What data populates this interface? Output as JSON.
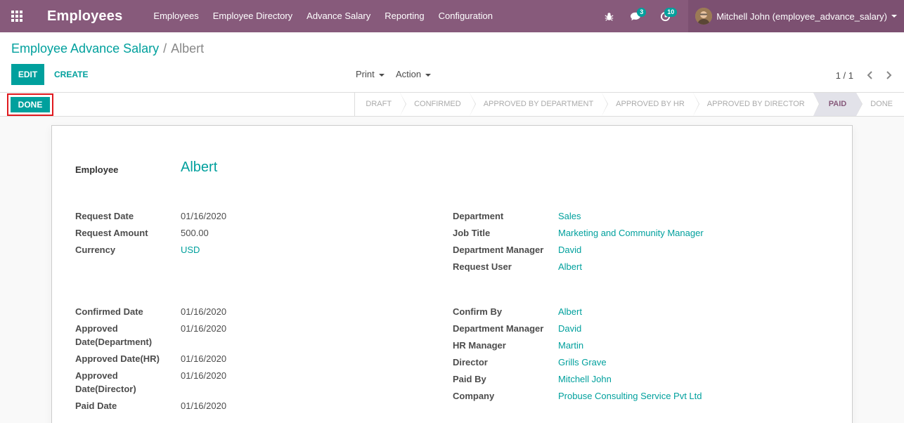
{
  "navbar": {
    "app_title": "Employees",
    "menu": [
      "Employees",
      "Employee Directory",
      "Advance Salary",
      "Reporting",
      "Configuration"
    ],
    "messages_count": "3",
    "activities_count": "10",
    "user": "Mitchell John (employee_advance_salary)"
  },
  "breadcrumb": {
    "parent": "Employee Advance Salary",
    "separator": "/",
    "current": "Albert"
  },
  "buttons": {
    "edit": "EDIT",
    "create": "CREATE",
    "print": "Print",
    "action": "Action",
    "done": "DONE"
  },
  "pager": {
    "value": "1 / 1"
  },
  "stages": [
    "DRAFT",
    "CONFIRMED",
    "APPROVED BY DEPARTMENT",
    "APPROVED BY HR",
    "APPROVED BY DIRECTOR",
    "PAID",
    "DONE"
  ],
  "active_stage": "PAID",
  "form": {
    "employee_label": "Employee",
    "employee": "Albert",
    "left1": [
      {
        "label": "Request Date",
        "value": "01/16/2020"
      },
      {
        "label": "Request Amount",
        "value": "500.00"
      },
      {
        "label": "Currency",
        "value": "USD"
      }
    ],
    "right1": [
      {
        "label": "Department",
        "value": "Sales"
      },
      {
        "label": "Job Title",
        "value": "Marketing and Community Manager"
      },
      {
        "label": "Department Manager",
        "value": "David"
      },
      {
        "label": "Request User",
        "value": "Albert"
      }
    ],
    "left2": [
      {
        "label": "Confirmed Date",
        "value": "01/16/2020"
      },
      {
        "label": "Approved Date(Department)",
        "value": "01/16/2020"
      },
      {
        "label": "Approved Date(HR)",
        "value": "01/16/2020"
      },
      {
        "label": "Approved Date(Director)",
        "value": "01/16/2020"
      },
      {
        "label": "Paid Date",
        "value": "01/16/2020"
      }
    ],
    "right2": [
      {
        "label": "Confirm By",
        "value": "Albert"
      },
      {
        "label": "Department Manager",
        "value": "David"
      },
      {
        "label": "HR Manager",
        "value": "Martin"
      },
      {
        "label": "Director",
        "value": "Grills Grave"
      },
      {
        "label": "Paid By",
        "value": "Mitchell John"
      },
      {
        "label": "Company",
        "value": "Probuse Consulting Service Pvt Ltd"
      }
    ]
  },
  "colors": {
    "brand": "#875a7b",
    "accent": "#00a09d",
    "highlight_border": "#e0191e"
  }
}
